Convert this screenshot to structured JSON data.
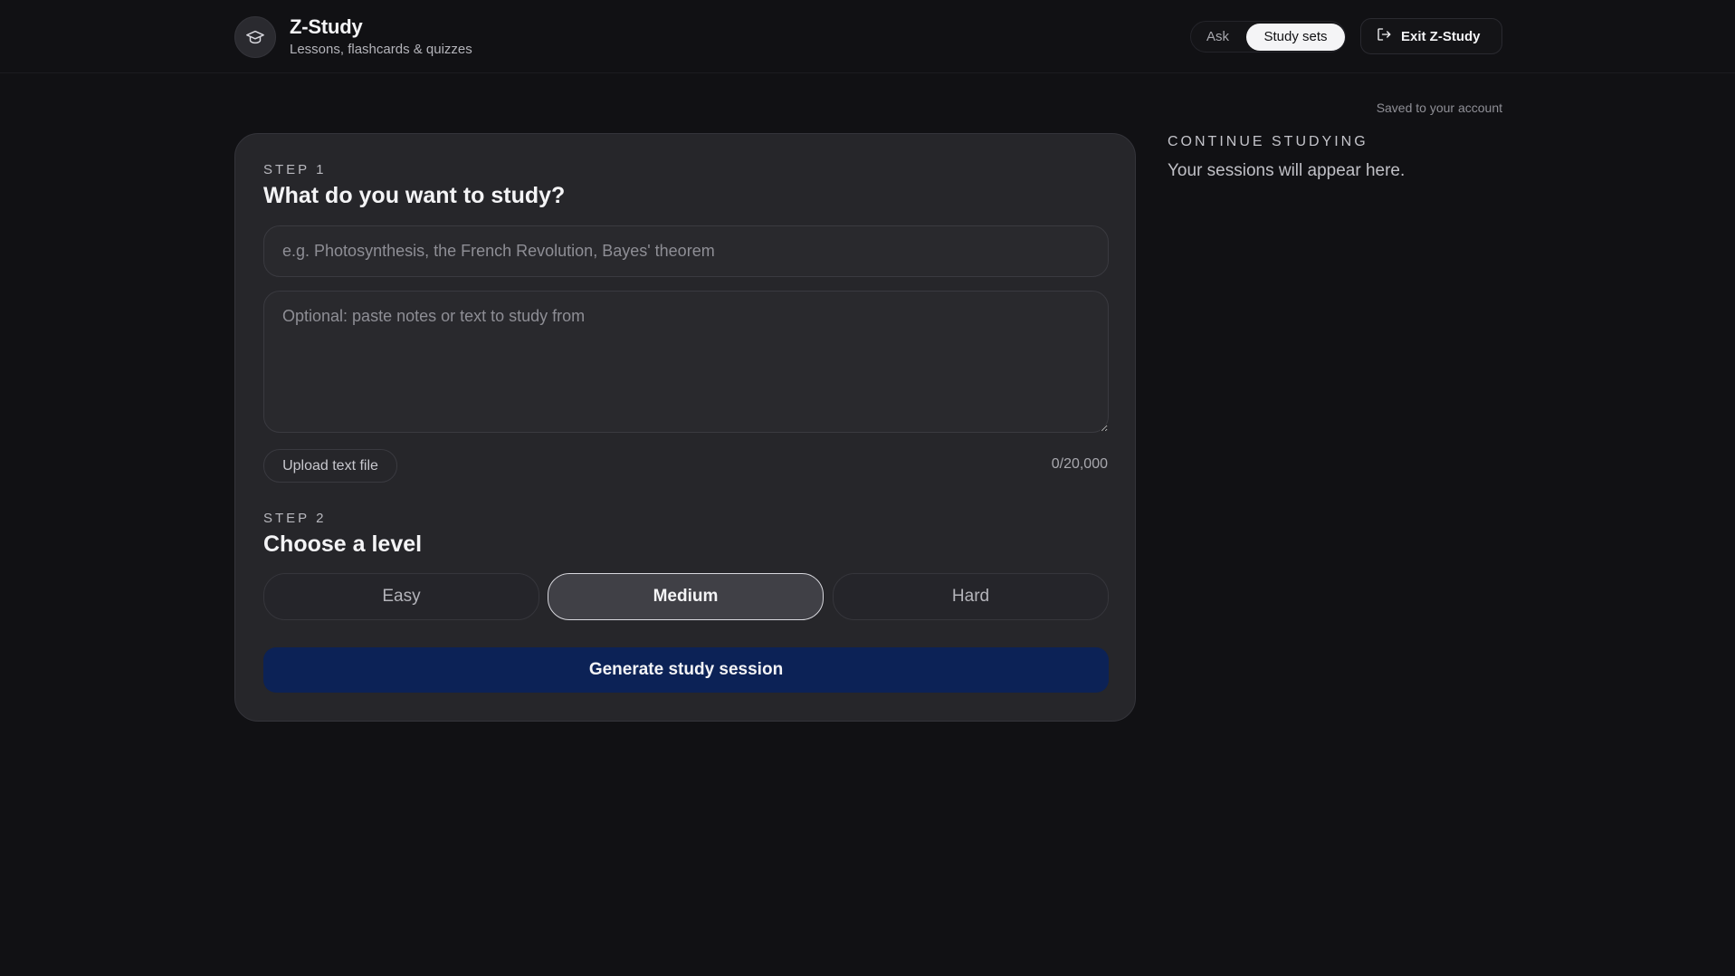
{
  "app": {
    "title": "Z-Study",
    "subtitle": "Lessons, flashcards & quizzes",
    "logo_icon": "graduation-cap-icon"
  },
  "nav": {
    "ask_label": "Ask",
    "study_sets_label": "Study sets",
    "active": "Study sets"
  },
  "exit": {
    "label": "Exit Z-Study",
    "icon": "logout-icon"
  },
  "saved_note": "Saved to your account",
  "step1": {
    "label": "STEP 1",
    "title": "What do you want to study?",
    "topic_placeholder": "e.g. Photosynthesis, the French Revolution, Bayes' theorem",
    "topic_value": "",
    "notes_placeholder": "Optional: paste notes or text to study from",
    "notes_value": "",
    "upload_label": "Upload text file",
    "char_count": "0/20,000"
  },
  "step2": {
    "label": "STEP 2",
    "title": "Choose a level",
    "levels": [
      "Easy",
      "Medium",
      "Hard"
    ],
    "selected": "Medium"
  },
  "generate_label": "Generate study session",
  "continue": {
    "title": "CONTINUE STUDYING",
    "empty_text": "Your sessions will appear here."
  },
  "colors": {
    "background": "#111114",
    "card": "#26262a",
    "primary_button": "#0c2256"
  }
}
